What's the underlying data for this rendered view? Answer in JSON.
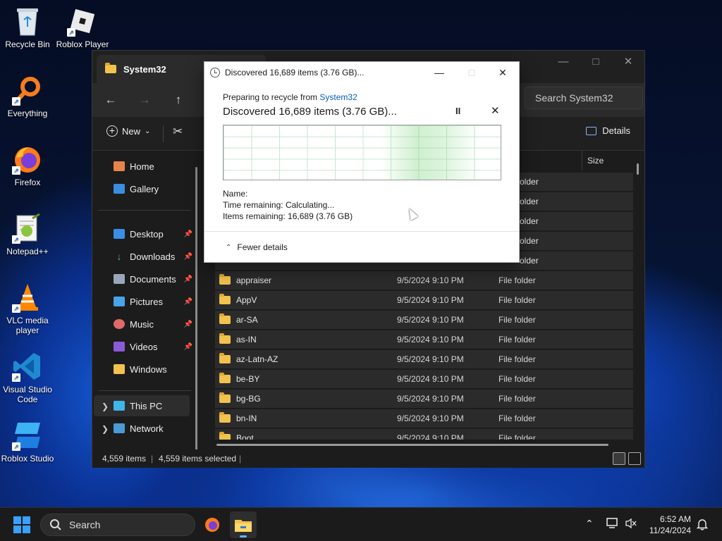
{
  "desktop": {
    "icons": [
      {
        "label": "Recycle Bin"
      },
      {
        "label": "Roblox Player"
      },
      {
        "label": "Everything"
      },
      {
        "label": "Firefox"
      },
      {
        "label": "Notepad++"
      },
      {
        "label": "VLC media player"
      },
      {
        "label": "Visual Studio Code"
      },
      {
        "label": "Roblox Studio"
      }
    ]
  },
  "explorer": {
    "tab_title": "System32",
    "search_placeholder": "Search System32",
    "toolbar": {
      "new_label": "New",
      "new_chevron": "⌄",
      "details_label": "Details"
    },
    "columns": {
      "size": "Size"
    },
    "sidebar": {
      "home": "Home",
      "gallery": "Gallery",
      "quick_access": [
        {
          "label": "Desktop",
          "pinned": true
        },
        {
          "label": "Downloads",
          "pinned": true
        },
        {
          "label": "Documents",
          "pinned": true
        },
        {
          "label": "Pictures",
          "pinned": true
        },
        {
          "label": "Music",
          "pinned": true
        },
        {
          "label": "Videos",
          "pinned": true
        },
        {
          "label": "Windows",
          "pinned": false
        }
      ],
      "this_pc": "This PC",
      "network": "Network"
    },
    "partial_type_labels": [
      "older",
      "older",
      "older",
      "older",
      "older"
    ],
    "files": [
      {
        "name": "appraiser",
        "date": "9/5/2024 9:10 PM",
        "type": "File folder"
      },
      {
        "name": "AppV",
        "date": "9/5/2024 9:10 PM",
        "type": "File folder"
      },
      {
        "name": "ar-SA",
        "date": "9/5/2024 9:10 PM",
        "type": "File folder"
      },
      {
        "name": "as-IN",
        "date": "9/5/2024 9:10 PM",
        "type": "File folder"
      },
      {
        "name": "az-Latn-AZ",
        "date": "9/5/2024 9:10 PM",
        "type": "File folder"
      },
      {
        "name": "be-BY",
        "date": "9/5/2024 9:10 PM",
        "type": "File folder"
      },
      {
        "name": "bg-BG",
        "date": "9/5/2024 9:10 PM",
        "type": "File folder"
      },
      {
        "name": "bn-IN",
        "date": "9/5/2024 9:10 PM",
        "type": "File folder"
      },
      {
        "name": "Boot",
        "date": "9/5/2024 9:10 PM",
        "type": "File folder"
      }
    ],
    "status": {
      "items": "4,559 items",
      "selected": "4,559 items selected"
    }
  },
  "dialog": {
    "title": "Discovered 16,689 items (3.76 GB)...",
    "from_prefix": "Preparing to recycle from",
    "from_link": "System32",
    "heading": "Discovered 16,689 items (3.76 GB)...",
    "pause_symbol": "II",
    "close_symbol": "✕",
    "name_label": "Name:",
    "name_value": "",
    "time_label": "Time remaining:",
    "time_value": "Calculating...",
    "items_label": "Items remaining:",
    "items_value": "16,689 (3.76 GB)",
    "fewer_details": "Fewer details"
  },
  "taskbar": {
    "search_label": "Search",
    "time": "6:52 AM",
    "date": "11/24/2024"
  },
  "colors": {
    "accent": "#3aa0ff",
    "folder": "#f1c24d",
    "link": "#0a5bc4"
  }
}
